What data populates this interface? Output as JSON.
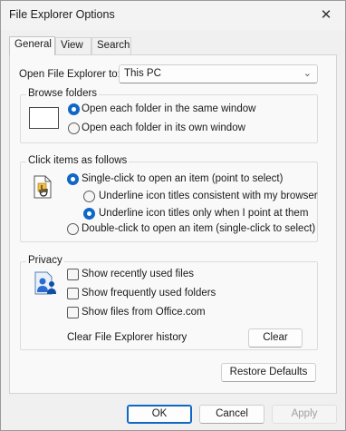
{
  "window": {
    "title": "File Explorer Options",
    "close_glyph": "✕"
  },
  "tabs": [
    {
      "label": "General",
      "active": true
    },
    {
      "label": "View",
      "active": false
    },
    {
      "label": "Search",
      "active": false
    }
  ],
  "open_to": {
    "label": "Open File Explorer to:",
    "value": "This PC",
    "chevron": "⌄"
  },
  "browse": {
    "title": "Browse folders",
    "options": [
      {
        "label": "Open each folder in the same window",
        "selected": true
      },
      {
        "label": "Open each folder in its own window",
        "selected": false
      }
    ]
  },
  "click": {
    "title": "Click items as follows",
    "single": {
      "label": "Single-click to open an item (point to select)",
      "selected": true
    },
    "underline_browser": {
      "label": "Underline icon titles consistent with my browser",
      "selected": false
    },
    "underline_point": {
      "label": "Underline icon titles only when I point at them",
      "selected": true
    },
    "double": {
      "label": "Double-click to open an item (single-click to select)",
      "selected": false
    }
  },
  "privacy": {
    "title": "Privacy",
    "checks": [
      {
        "label": "Show recently used files",
        "checked": false
      },
      {
        "label": "Show frequently used folders",
        "checked": false
      },
      {
        "label": "Show files from Office.com",
        "checked": false
      }
    ],
    "clear_label": "Clear File Explorer history",
    "clear_button": "Clear"
  },
  "restore_defaults": "Restore Defaults",
  "footer": {
    "ok": "OK",
    "cancel": "Cancel",
    "apply": "Apply"
  },
  "colors": {
    "accent": "#0f67c6",
    "panel": "#f9f9f9",
    "window": "#f0f0f0"
  }
}
